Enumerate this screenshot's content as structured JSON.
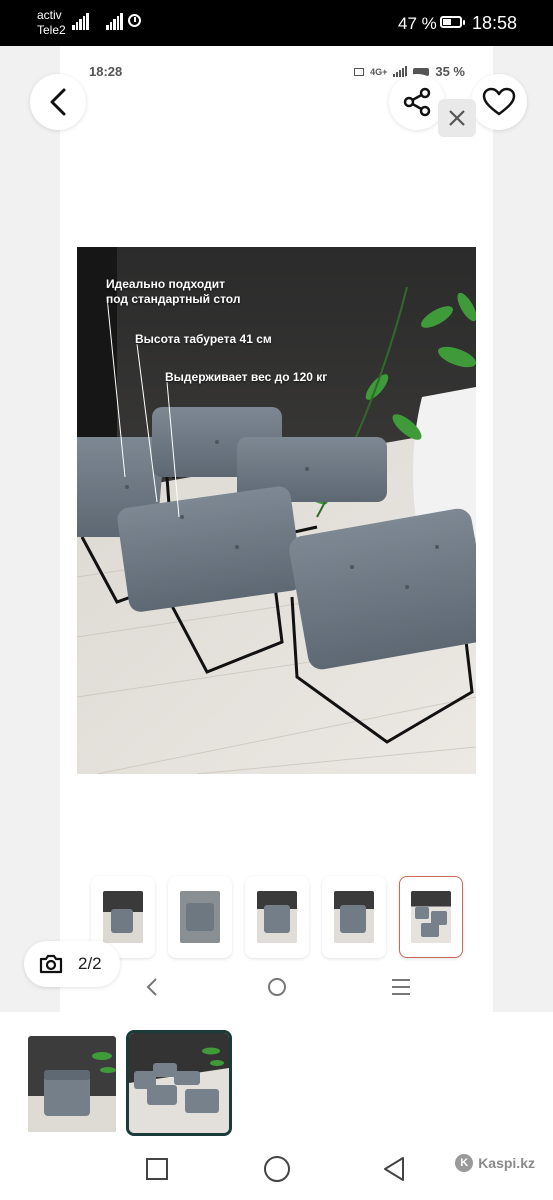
{
  "status_bar": {
    "carrier_line1": "activ",
    "carrier_line2": "Tele2",
    "battery_percent": "47 %",
    "battery_level": 0.47,
    "time": "18:58"
  },
  "inner_status_bar": {
    "time": "18:28",
    "network": "4G+",
    "battery_percent": "35 %"
  },
  "icons": {
    "back": "chevron-left-icon",
    "share": "share-icon",
    "favorite": "heart-icon",
    "close": "close-icon",
    "camera": "camera-icon"
  },
  "product_image": {
    "captions": [
      "Идеально подходит\nпод стандартный стол",
      "Высота табурета 41 см",
      "Выдерживает вес до 120 кг"
    ]
  },
  "thumbnails": {
    "count": 5,
    "active_index": 4
  },
  "photo_counter": {
    "text": "2/2"
  },
  "bottom_strip": {
    "count": 2,
    "selected_index": 1
  },
  "footer": {
    "brand": "Kaspi.kz"
  },
  "colors": {
    "status_bar_bg": "#000000",
    "active_thumb_border": "#c76a5a",
    "selected_strip_border": "#1b3a3a",
    "background": "#f1f1f1"
  }
}
